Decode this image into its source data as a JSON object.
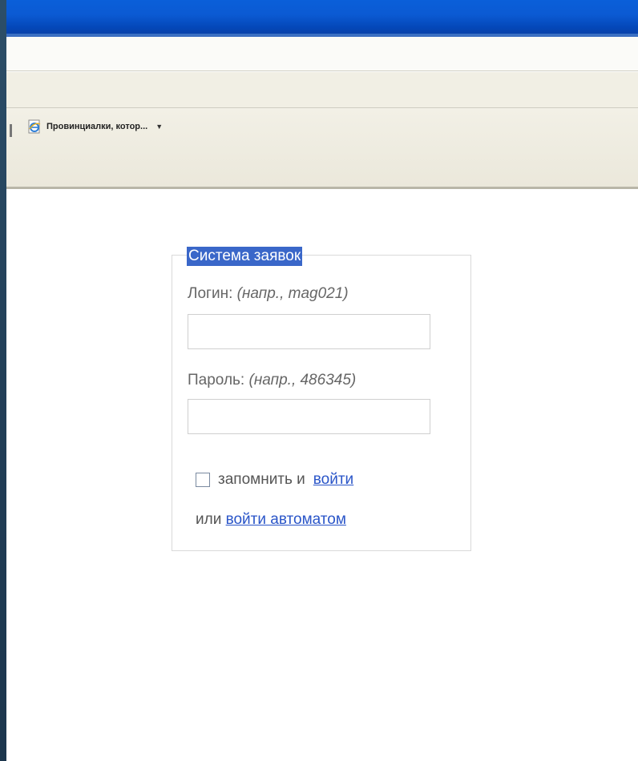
{
  "browser": {
    "favorites": [
      {
        "label": "Провинциалки, котор...",
        "icon": "ie-page-icon"
      }
    ],
    "colors": {
      "title_bar": "#0b5ad3",
      "toolbar": "#f1efe4"
    }
  },
  "login": {
    "legend": "Система заявок",
    "login_label": "Логин:",
    "login_hint": "(напр., mag021)",
    "login_value": "",
    "password_label": "Пароль:",
    "password_hint": "(напр., 486345)",
    "password_value": "",
    "remember_text": "запомнить и",
    "login_link": "войти",
    "or_text": "или",
    "auto_login_link": "войти автоматом",
    "remember_checked": false,
    "accent_color": "#3a67c9",
    "link_color": "#2a55c8"
  }
}
